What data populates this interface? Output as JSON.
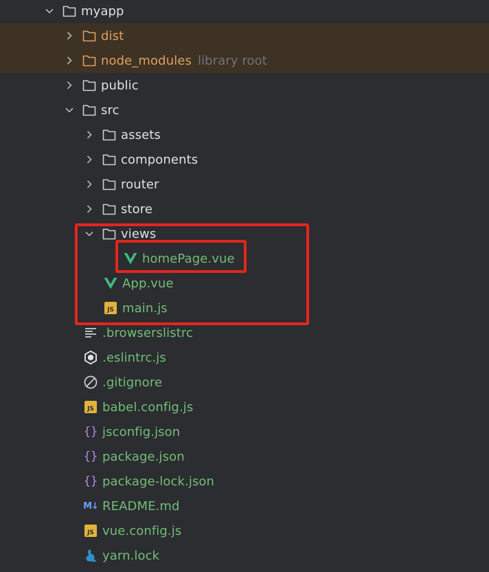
{
  "project_tree": {
    "root": {
      "label": "myapp"
    },
    "items": [
      {
        "label": "dist",
        "hint": ""
      },
      {
        "label": "node_modules",
        "hint": "library root"
      },
      {
        "label": "public"
      },
      {
        "label": "src"
      },
      {
        "label": "assets"
      },
      {
        "label": "components"
      },
      {
        "label": "router"
      },
      {
        "label": "store"
      },
      {
        "label": "views"
      },
      {
        "label": "homePage.vue"
      },
      {
        "label": "App.vue"
      },
      {
        "label": "main.js"
      },
      {
        "label": ".browserslistrc"
      },
      {
        "label": ".eslintrc.js"
      },
      {
        "label": ".gitignore"
      },
      {
        "label": "babel.config.js"
      },
      {
        "label": "jsconfig.json"
      },
      {
        "label": "package.json"
      },
      {
        "label": "package-lock.json"
      },
      {
        "label": "README.md"
      },
      {
        "label": "vue.config.js"
      },
      {
        "label": "yarn.lock"
      }
    ]
  },
  "badges": {
    "js": "JS",
    "md": "M↓",
    "json": "{}"
  },
  "colors": {
    "background": "#2b2d30",
    "excluded_row": "#3d3223",
    "excluded_text": "#e0a062",
    "vcs_added_text": "#73bd79",
    "default_text": "#dfe1e5",
    "hint_text": "#6f737a",
    "vue_icon": "#41b883",
    "js_badge": "#e2b33c",
    "highlight_box": "#e5251f"
  },
  "icons": {
    "expanded": "chevron-down-icon",
    "collapsed": "chevron-right-icon",
    "folder": "folder-icon",
    "vue": "vue-file-icon",
    "js": "js-file-icon",
    "text": "text-file-icon",
    "eslint": "eslint-file-icon",
    "ignore": "ignore-file-icon",
    "json": "json-file-icon",
    "markdown": "markdown-file-icon",
    "yarn": "yarn-file-icon"
  }
}
